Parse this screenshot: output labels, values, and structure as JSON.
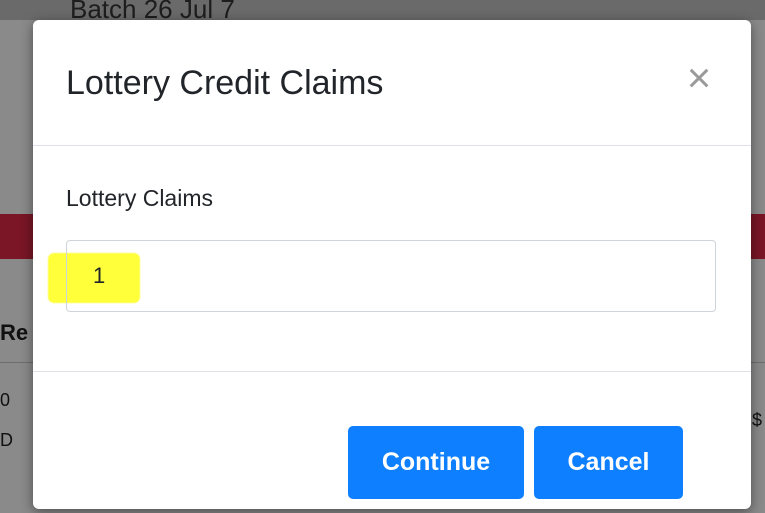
{
  "background": {
    "partial_title": "Batch 26   Jul 7",
    "partial_heading": "Re",
    "partial_row_1": "0",
    "partial_row_2": "D",
    "partial_right": "$"
  },
  "modal": {
    "title": "Lottery Credit Claims",
    "close_glyph": "×",
    "field_label": "Lottery Claims",
    "field_value": "1",
    "highlight_color": "#ffff3a",
    "continue_label": "Continue",
    "cancel_label": "Cancel",
    "button_color": "#0d7fff"
  }
}
